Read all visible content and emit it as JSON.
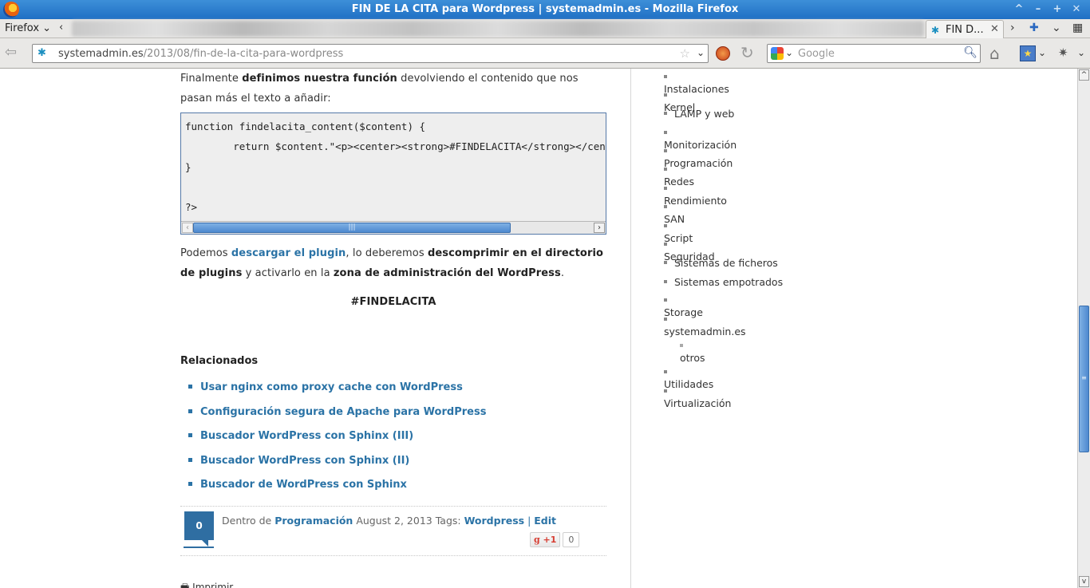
{
  "window": {
    "title": "FIN DE LA CITA para Wordpress | systemadmin.es - Mozilla Firefox",
    "controls": [
      "^",
      "–",
      "+",
      "✕"
    ]
  },
  "tabbar": {
    "menu_label": "Firefox",
    "active_tab_label": "FIN D..."
  },
  "navbar": {
    "url_host": "systemadmin.es",
    "url_path": "/2013/08/fin-de-la-cita-para-wordpress",
    "search_placeholder": "Google"
  },
  "post": {
    "intro": {
      "pre": "Finalmente ",
      "bold": "definimos nuestra función",
      "post": " devolviendo el contenido que nos pasan más el texto a añadir:"
    },
    "code": "function findelacita_content($content) {\n        return $content.\"<p><center><strong>#FINDELACITA</strong></center></p>\";\n}\n\n?>",
    "download": {
      "p1": "Podemos ",
      "link": "descargar el plugin",
      "p2": ", lo deberemos ",
      "b1": "descomprimir en el directorio de plugins",
      "p3": " y activarlo en la ",
      "b2": "zona de administración del WordPress",
      "p4": "."
    },
    "hashtag": "#FINDELACITA",
    "related_title": "Relacionados",
    "related": [
      "Usar nginx como proxy cache con WordPress",
      "Configuración segura de Apache para WordPress",
      "Buscador WordPress con Sphinx (III)",
      "Buscador WordPress con Sphinx (II)",
      "Buscador de WordPress con Sphinx"
    ],
    "meta": {
      "comments": "0",
      "dentro_de": "Dentro de ",
      "category": "Programación",
      "date": " August 2, 2013 Tags: ",
      "tag": "Wordpress",
      "sep": " | ",
      "edit": "Edit",
      "gplus_label": "+1",
      "gplus_count": "0"
    },
    "bottom_cut_text": "Imprimir"
  },
  "sidebar": {
    "categories": [
      "Instalaciones",
      "Kernel",
      "LAMP y web",
      "Monitorización",
      "Programación",
      "Redes",
      "Rendimiento",
      "SAN",
      "Script",
      "Seguridad",
      "Sistemas de ficheros",
      "Sistemas empotrados",
      "Storage",
      "systemadmin.es"
    ],
    "subcategories": [
      "otros"
    ],
    "categories_after": [
      "Utilidades",
      "Virtualización"
    ]
  },
  "colors": {
    "link": "#2b73a6",
    "titlebar": "#1f6fc4",
    "code_border": "#5579a8"
  }
}
